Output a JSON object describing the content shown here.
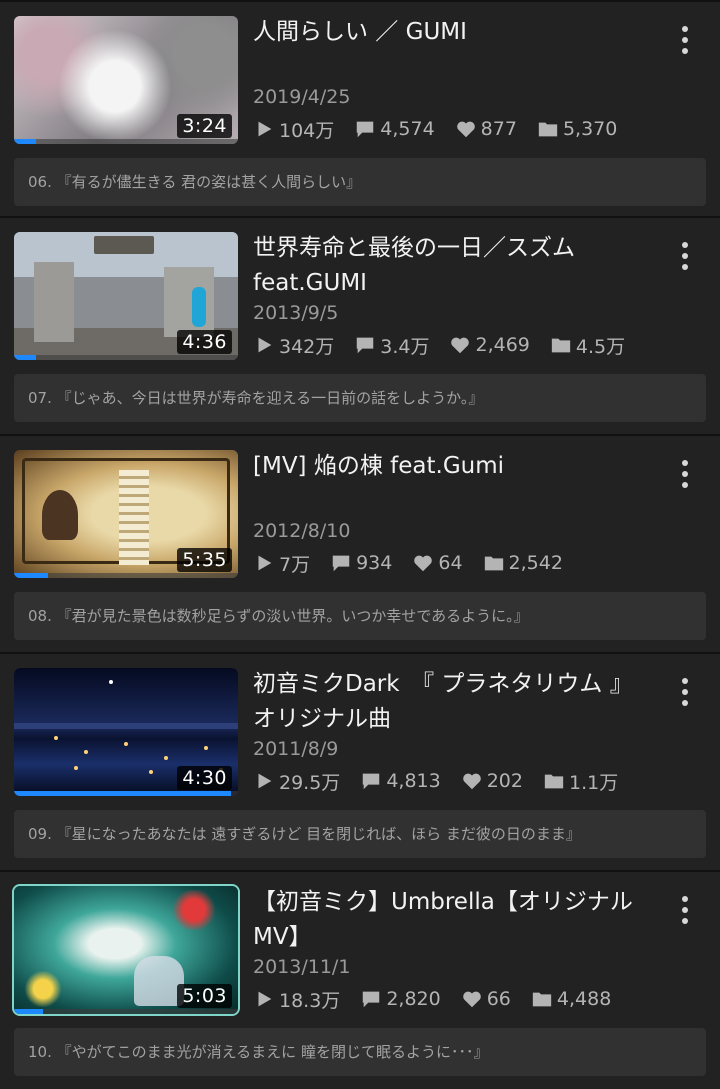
{
  "icons": {
    "views": "play-icon",
    "comments": "comment-icon",
    "likes": "heart-icon",
    "mylists": "folder-icon",
    "menu": "more-vertical-icon"
  },
  "colors": {
    "background": "#222222",
    "card_description": "#313131",
    "progress": "#1e88ff",
    "stat_text": "#b4b4b4"
  },
  "videos": [
    {
      "title": "人間らしい ／ GUMI",
      "duration": "3:24",
      "progress": 0.1,
      "date": "2019/4/25",
      "views": "104万",
      "comments": "4,574",
      "likes": "877",
      "mylists": "5,370",
      "description": "06. 『有るが儘生きる 君の姿は甚く人間らしい』"
    },
    {
      "title": "世界寿命と最後の一日／スズム feat.GUMI",
      "duration": "4:36",
      "progress": 0.1,
      "date": "2013/9/5",
      "views": "342万",
      "comments": "3.4万",
      "likes": "2,469",
      "mylists": "4.5万",
      "description": "07. 『じゃあ、今日は世界が寿命を迎える一日前の話をしようか。』"
    },
    {
      "title": "[MV] 焔の棟 feat.Gumi",
      "duration": "5:35",
      "progress": 0.15,
      "date": "2012/8/10",
      "views": "7万",
      "comments": "934",
      "likes": "64",
      "mylists": "2,542",
      "description": "08. 『君が見た景色は数秒足らずの淡い世界。いつか幸せであるように。』"
    },
    {
      "title": "初音ミクDark　『 プラネタリウム 』オリジナル曲",
      "duration": "4:30",
      "progress": 0.97,
      "date": "2011/8/9",
      "views": "29.5万",
      "comments": "4,813",
      "likes": "202",
      "mylists": "1.1万",
      "description": "09. 『星になったあなたは 遠すぎるけど 目を閉じれば、ほら まだ彼の日のまま』"
    },
    {
      "title": "【初音ミク】Umbrella【オリジナルMV】",
      "duration": "5:03",
      "progress": 0.13,
      "date": "2013/11/1",
      "views": "18.3万",
      "comments": "2,820",
      "likes": "66",
      "mylists": "4,488",
      "description": "10. 『やがてこのまま光が消えるまえに 瞳を閉じて眠るように･･･』"
    }
  ]
}
